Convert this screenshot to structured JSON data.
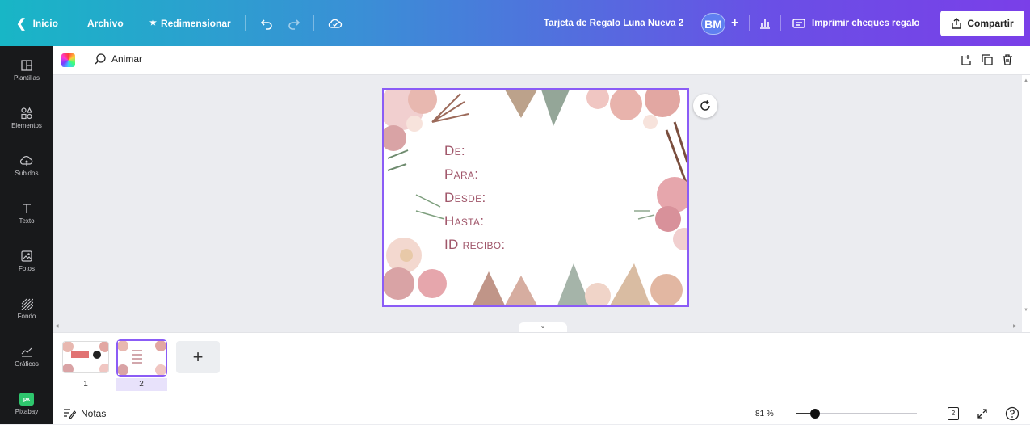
{
  "topbar": {
    "home_label": "Inicio",
    "file_label": "Archivo",
    "resize_label": "Redimensionar",
    "doc_title": "Tarjeta de Regalo Luna Nueva 2",
    "avatar_initials": "BM",
    "add_label": "+",
    "print_label": "Imprimir cheques regalo",
    "share_label": "Compartir"
  },
  "sidebar": {
    "items": [
      {
        "label": "Plantillas",
        "icon": "templates-icon"
      },
      {
        "label": "Elementos",
        "icon": "elements-icon"
      },
      {
        "label": "Subidos",
        "icon": "upload-icon"
      },
      {
        "label": "Texto",
        "icon": "text-icon"
      },
      {
        "label": "Fotos",
        "icon": "photos-icon"
      },
      {
        "label": "Fondo",
        "icon": "background-icon"
      },
      {
        "label": "Gráficos",
        "icon": "charts-icon"
      },
      {
        "label": "Pixabay",
        "icon": "pixabay-icon"
      }
    ]
  },
  "context": {
    "animate_label": "Animar"
  },
  "card": {
    "lines": [
      "De:",
      "Para:",
      "Desde:",
      "Hasta:",
      "ID recibo:"
    ]
  },
  "pages": {
    "items": [
      {
        "number": "1"
      },
      {
        "number": "2"
      }
    ],
    "add_label": "+"
  },
  "footer": {
    "notes_label": "Notas",
    "zoom_label": "81 %",
    "zoom_value": 81
  },
  "colors": {
    "accent": "#8b5cf6",
    "card_text": "#a0566a",
    "sidebar_bg": "#18191b"
  }
}
